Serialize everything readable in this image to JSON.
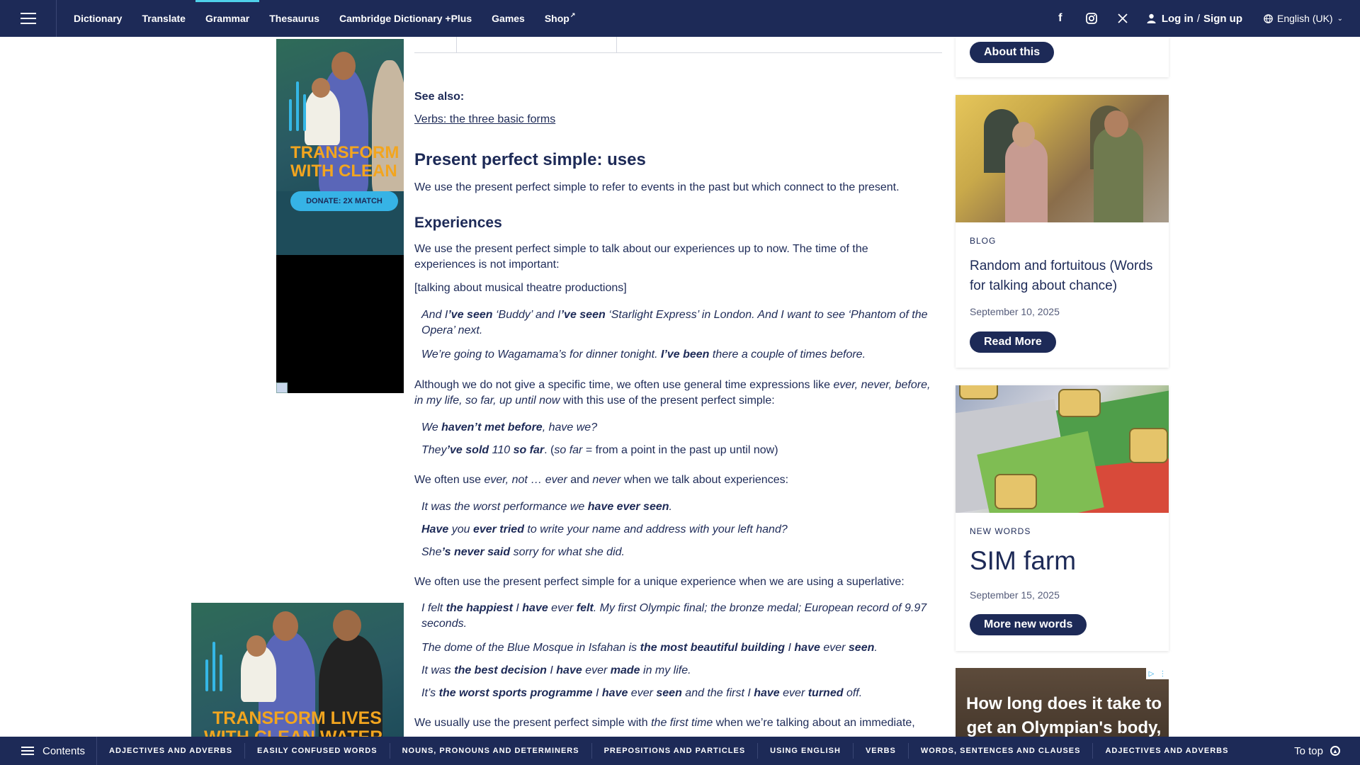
{
  "nav": {
    "links": [
      "Dictionary",
      "Translate",
      "Grammar",
      "Thesaurus",
      "Cambridge Dictionary +Plus",
      "Games",
      "Shop"
    ],
    "active": "Grammar",
    "login": "Log in",
    "signup": "Sign up",
    "slash": "/",
    "language": "English (UK)"
  },
  "ads": {
    "ad1_line1": "TRANSFORM",
    "ad1_line2": "WITH CLEAN",
    "ad1_donate": "DONATE: 2X MATCH",
    "ad2_line1": "TRANSFORM LIVES",
    "ad2_line2": "WITH CLEAN WATER",
    "ad3_text": "How long does it take to get an Olympian's body, with"
  },
  "article": {
    "see_also_label": "See also:",
    "see_also_link": "Verbs: the three basic forms",
    "heading": "Present perfect simple: uses",
    "intro": "We use the present perfect simple to refer to events in the past but which connect to the present.",
    "subheading": "Experiences",
    "p1": "We use the present perfect simple to talk about our experiences up to now. The time of the experiences is not important:",
    "p1_note": "[talking about musical theatre productions]",
    "ex1": [
      "And I",
      "’ve seen",
      " ‘Buddy’ and I",
      "’ve seen",
      " ‘Starlight Express’ in London. And I want to see ‘Phantom of the Opera’ next."
    ],
    "ex2": [
      "We’re going to Wagamama’s for dinner tonight. ",
      "I’ve been",
      " there a couple of times before."
    ],
    "p2": [
      "Although we do not give a specific time, we often use general time expressions like ",
      "ever, never, before, in my life, so far, up until now",
      " with this use of the present perfect simple:"
    ],
    "ex3": [
      "We ",
      "haven’t met before",
      ", have we?"
    ],
    "ex4": [
      "They",
      "’ve sold",
      " 110 ",
      "so far",
      ". (",
      "so far",
      " = from a point in the past up until now)"
    ],
    "p3": [
      "We often use ",
      "ever, not … ever",
      " and ",
      "never",
      " when we talk about experiences:"
    ],
    "ex5": [
      "It was the worst performance we ",
      "have ever seen",
      "."
    ],
    "ex6": [
      "Have",
      " you ",
      "ever tried",
      " to write your name and address with your left hand?"
    ],
    "ex7": [
      "She",
      "’s never said",
      " sorry for what she did."
    ],
    "p4": "We often use the present perfect simple for a unique experience when we are using a superlative:",
    "ex8": [
      "I felt ",
      "the happiest",
      " I ",
      "have",
      " ever ",
      "felt",
      ". My first Olympic final; the bronze medal; European record of 9.97 seconds."
    ],
    "ex9": [
      "The dome of the Blue Mosque in Isfahan is ",
      "the most beautiful building",
      " I ",
      "have",
      " ever ",
      "seen",
      "."
    ],
    "ex10": [
      "It was ",
      "the best decision",
      " I ",
      "have",
      " ever ",
      "made",
      " in my life."
    ],
    "ex11": [
      "It’s ",
      "the worst sports programme",
      " I ",
      "have",
      " ever ",
      "seen",
      " and the first I ",
      "have",
      " ever ",
      "turned",
      " off."
    ],
    "p5": [
      "We usually use the present perfect simple with ",
      "the first time",
      " when we’re talking about an immediate,"
    ]
  },
  "sidebar": {
    "about_button": "About this",
    "blog_category": "BLOG",
    "blog_title": "Random and fortuitous (Words for talking about chance)",
    "blog_date": "September 10, 2025",
    "read_more": "Read More",
    "nw_category": "NEW WORDS",
    "nw_title": "SIM farm",
    "nw_date": "September 15, 2025",
    "more_new_words": "More new words"
  },
  "bottombar": {
    "contents": "Contents",
    "categories": [
      "ADJECTIVES AND ADVERBS",
      "EASILY CONFUSED WORDS",
      "NOUNS, PRONOUNS AND DETERMINERS",
      "PREPOSITIONS AND PARTICLES",
      "USING ENGLISH",
      "VERBS",
      "WORDS, SENTENCES AND CLAUSES",
      "ADJECTIVES AND ADVERBS"
    ],
    "to_top": "To top"
  },
  "colors": {
    "brand_navy": "#1d2a57",
    "accent_cyan": "#4fd0e9"
  }
}
